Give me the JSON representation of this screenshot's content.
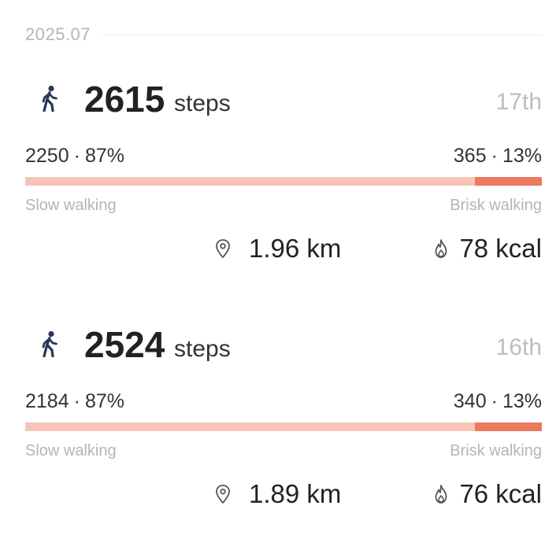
{
  "month": "2025.07",
  "days": [
    {
      "steps": "2615",
      "steps_unit": "steps",
      "date": "17th",
      "slow_count": "2250",
      "slow_pct": "87%",
      "brisk_count": "365",
      "brisk_pct": "13%",
      "brisk_fraction": 0.13,
      "slow_label": "Slow walking",
      "brisk_label": "Brisk walking",
      "distance": "1.96 km",
      "calories": "78 kcal"
    },
    {
      "steps": "2524",
      "steps_unit": "steps",
      "date": "16th",
      "slow_count": "2184",
      "slow_pct": "87%",
      "brisk_count": "340",
      "brisk_pct": "13%",
      "brisk_fraction": 0.13,
      "slow_label": "Slow walking",
      "brisk_label": "Brisk walking",
      "distance": "1.89 km",
      "calories": "76 kcal"
    }
  ],
  "separator": "·",
  "colors": {
    "slow_bar": "#f6c5b6",
    "brisk_bar": "#ec7a5c",
    "muted_text": "#b5b5b5",
    "primary_text": "#222222"
  },
  "icons": {
    "walk": "walking-person-icon",
    "distance": "location-pin-icon",
    "calories": "flame-icon"
  }
}
